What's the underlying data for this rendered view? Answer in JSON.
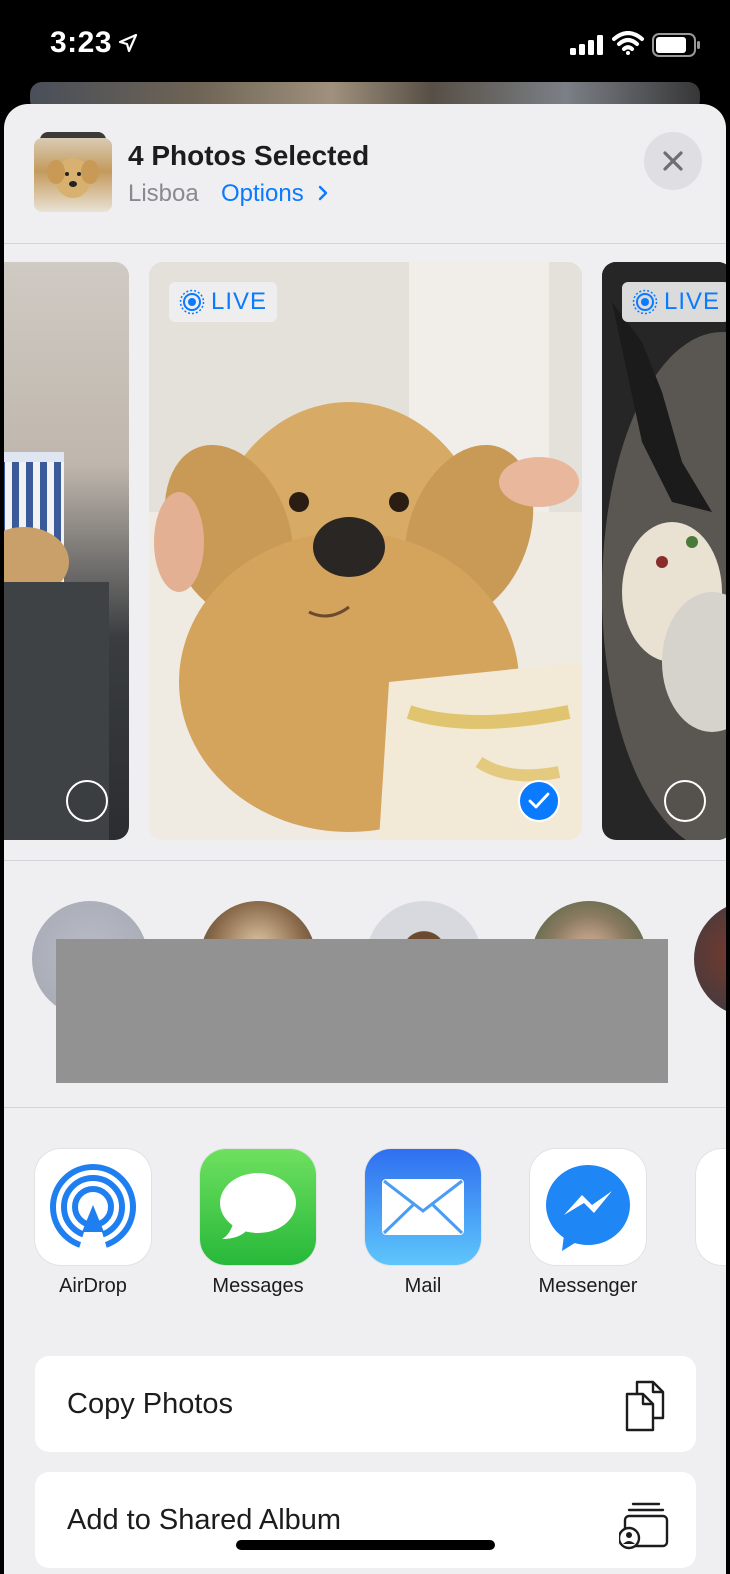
{
  "status_bar": {
    "time": "3:23"
  },
  "header": {
    "title": "4 Photos Selected",
    "location": "Lisboa",
    "options_label": "Options"
  },
  "photos": [
    {
      "id": "left",
      "live_label": "",
      "selected": false
    },
    {
      "id": "center",
      "live_label": "LIVE",
      "selected": true
    },
    {
      "id": "right",
      "live_label": "LIVE",
      "selected": false
    }
  ],
  "apps": [
    {
      "label": "AirDrop",
      "icon": "airdrop-icon"
    },
    {
      "label": "Messages",
      "icon": "messages-icon"
    },
    {
      "label": "Mail",
      "icon": "mail-icon"
    },
    {
      "label": "Messenger",
      "icon": "messenger-icon"
    }
  ],
  "actions": [
    {
      "label": "Copy Photos",
      "icon": "copy-icon"
    },
    {
      "label": "Add to Shared Album",
      "icon": "shared-album-icon"
    }
  ],
  "colors": {
    "accent": "#0a7aff",
    "sheet_bg": "#efeff2"
  }
}
